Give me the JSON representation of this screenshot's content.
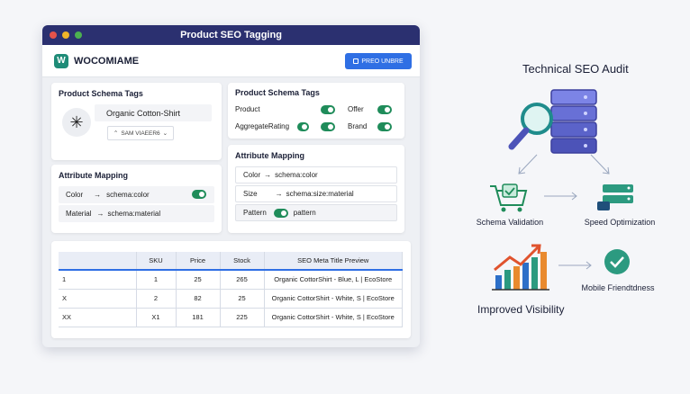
{
  "window": {
    "title": "Product SEO Tagging",
    "dot_colors": [
      "#e5534b",
      "#f0b429",
      "#4cb050"
    ],
    "logo_letter": "W",
    "logo_text": "WOCOMIAME",
    "pro_button": "PREO UNBRE"
  },
  "schema_left": {
    "title": "Product Schema Tags",
    "product_name": "Organic Cotton-Shirt",
    "select_value": "SAM VIAEER6"
  },
  "schema_right": {
    "title": "Product Schema Tags",
    "items": [
      "Product",
      "Offer",
      "AggregateRating",
      "Brand"
    ]
  },
  "mapping_left": {
    "title": "Attribute Mapping",
    "rows": [
      {
        "attr": "Color",
        "arrow": "→",
        "target": "schema:color"
      },
      {
        "attr": "Material",
        "arrow": "→",
        "target": "schema:material"
      }
    ]
  },
  "mapping_right": {
    "title": "Attribute Mapping",
    "rows": [
      {
        "attr": "Color",
        "arrow": "→",
        "target": "schema:color"
      },
      {
        "attr": "Size",
        "arrow": "→",
        "target": "schema:size:material"
      },
      {
        "attr": "Pattern",
        "arrow": "",
        "target": "pattern"
      }
    ]
  },
  "table": {
    "headers": [
      "",
      "SKU",
      "Price",
      "Stock",
      "SEO Meta Title Preview"
    ],
    "rows": [
      [
        "1",
        "1",
        "25",
        "265",
        "Organic CottorShirt - Blue, L | EcoStore"
      ],
      [
        "X",
        "2",
        "82",
        "25",
        "Organic CottorShirt - White, S | EcoStore"
      ],
      [
        "XX",
        "X1",
        "181",
        "225",
        "Organic CottorShirt - White, S | EcoStore"
      ]
    ]
  },
  "audit": {
    "title": "Technical SEO Audit",
    "schema_validation": "Schema Validation",
    "speed_optimization": "Speed Optimization",
    "improved_visibility": "Improved Visibility",
    "mobile_friendliness": "Mobile Friendtdness"
  },
  "colors": {
    "accent": "#2f6fe4",
    "toggle_on": "#1f8c5a",
    "titlebar": "#2b3070"
  }
}
